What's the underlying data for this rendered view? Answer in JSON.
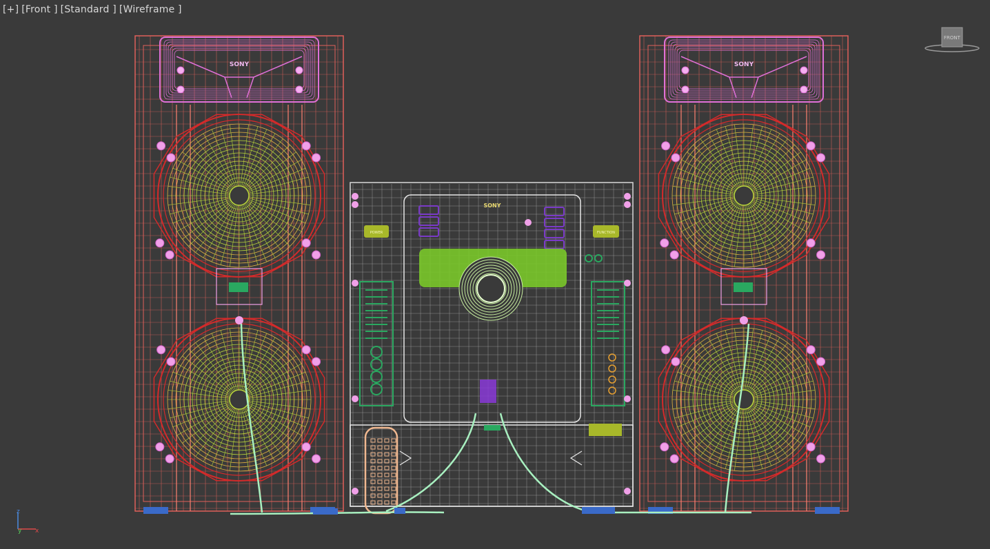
{
  "viewport": {
    "menu_plus": "[+]",
    "view": "[Front ]",
    "shading_mode": "[Standard ]",
    "display_mode": "[Wireframe ]"
  },
  "viewcube": {
    "face_label": "FRONT"
  },
  "axis_gizmo": {
    "z_label": "z",
    "x_label": "x",
    "y_label": "y"
  },
  "scene": {
    "speaker_left": {
      "brand": "SONY"
    },
    "speaker_right": {
      "brand": "SONY"
    },
    "main_unit": {
      "brand": "SONY",
      "left_button_label": "POWER",
      "right_button_label": "FUNCTION"
    }
  },
  "colors": {
    "background": "#3a3a3a",
    "speaker_cabinet": "#e0605a",
    "speaker_ring": "#d42a2a",
    "woofer_cone": "#b8d43a",
    "woofer_inner": "#e0b040",
    "tweeter_top": "#e070d8",
    "main_unit_wire": "#d8d8d8",
    "display_green": "#7ac82a",
    "panel_green": "#2aa860",
    "button_yellow": "#a8b82a",
    "purple_control": "#7a3ac8",
    "remote_orange": "#f0b890",
    "cable_mint": "#a8f0c0",
    "base_blue": "#3a6ac8"
  }
}
